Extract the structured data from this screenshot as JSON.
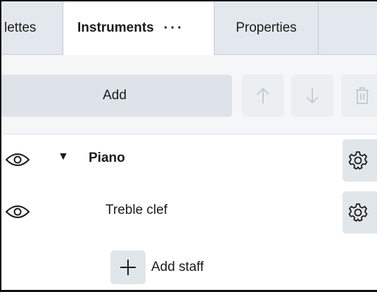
{
  "tabs": [
    {
      "label": "lettes"
    },
    {
      "label": "Instruments",
      "menu": "···",
      "active": true
    },
    {
      "label": "Properties"
    }
  ],
  "toolbar": {
    "add_label": "Add",
    "move_up_icon": "arrow-up-icon",
    "move_down_icon": "arrow-down-icon",
    "delete_icon": "trash-icon"
  },
  "instruments": [
    {
      "name": "Piano",
      "expanded": true,
      "visible": true
    },
    {
      "name": "Treble clef",
      "visible": true
    }
  ],
  "add_staff": {
    "label": "Add staff",
    "icon": "plus-icon"
  },
  "colors": {
    "tabbar": "#e3e8ee",
    "active_tab": "#ffffff",
    "button": "#dde3e9",
    "disabled_icon": "#c5ccd3"
  }
}
